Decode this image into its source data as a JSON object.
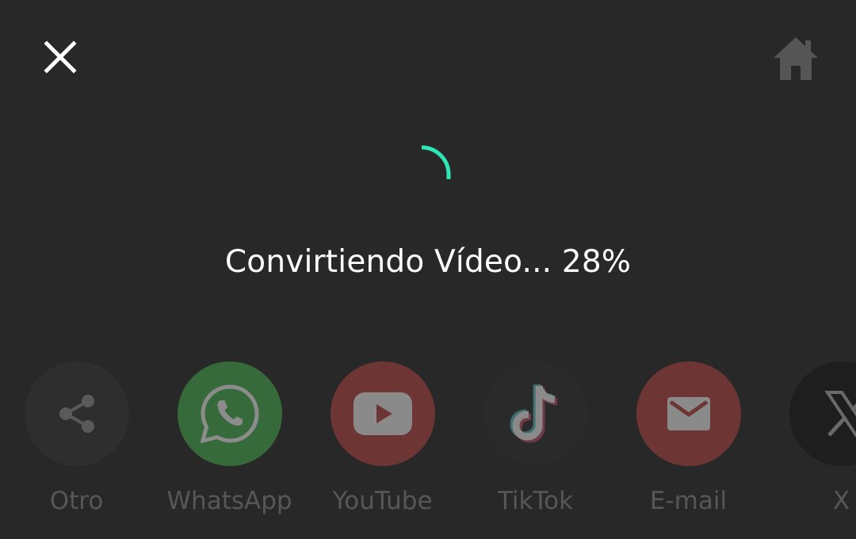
{
  "status": {
    "text": "Convirtiendo Vídeo... 28%",
    "progress_percent": 28
  },
  "icons": {
    "close": "close-icon",
    "home": "home-icon"
  },
  "colors": {
    "background": "#282828",
    "spinner_accent": "#2ee6b4",
    "whatsapp": "#366a3a",
    "youtube": "#6e3535",
    "email": "#6e3535"
  },
  "share": {
    "items": [
      {
        "label": "Otro",
        "icon": "share-icon"
      },
      {
        "label": "WhatsApp",
        "icon": "whatsapp-icon"
      },
      {
        "label": "YouTube",
        "icon": "youtube-icon"
      },
      {
        "label": "TikTok",
        "icon": "tiktok-icon"
      },
      {
        "label": "E-mail",
        "icon": "email-icon"
      },
      {
        "label": "X",
        "icon": "x-icon"
      }
    ]
  }
}
